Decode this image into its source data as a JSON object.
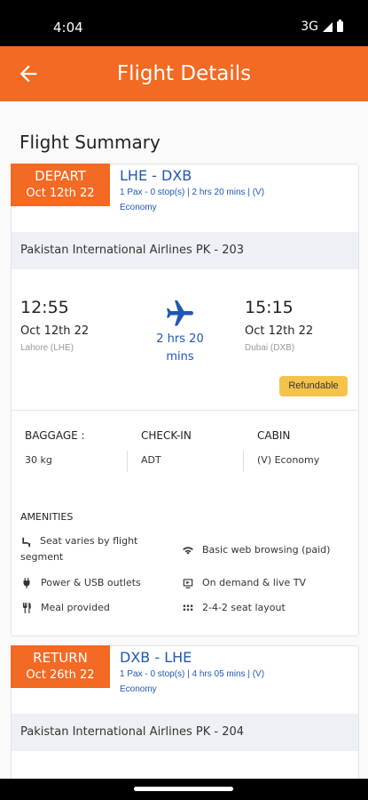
{
  "status": {
    "time": "4:04",
    "network": "3G"
  },
  "header": {
    "title": "Flight Details"
  },
  "summary_title": "Flight Summary",
  "depart": {
    "tag_type": "DEPART",
    "tag_date": "Oct 12th 22",
    "route": "LHE - DXB",
    "meta": "1 Pax - 0 stop(s) | 2 hrs 20 mins | (V)",
    "class": "Economy",
    "airline": "Pakistan International Airlines PK - 203",
    "dep_time": "12:55",
    "dep_date": "Oct 12th 22",
    "dep_city": "Lahore (LHE)",
    "duration": "2 hrs 20 mins",
    "arr_time": "15:15",
    "arr_date": "Oct 12th 22",
    "arr_city": "Dubai (DXB)",
    "refund_badge": "Refundable",
    "baggage_label": "BAGGAGE :",
    "baggage_value": "30 kg",
    "checkin_label": "CHECK-IN",
    "checkin_value": "ADT",
    "cabin_label": "CABIN",
    "cabin_value": "(V) Economy",
    "amenities_label": "AMENITIES",
    "amenities": [
      {
        "icon": "seat-icon",
        "text": "Seat varies by flight segment"
      },
      {
        "icon": "wifi-icon",
        "text": "Basic web browsing (paid)"
      },
      {
        "icon": "power-plug-icon",
        "text": "Power & USB outlets"
      },
      {
        "icon": "tv-icon",
        "text": "On demand & live TV"
      },
      {
        "icon": "meal-icon",
        "text": "Meal provided"
      },
      {
        "icon": "seat-layout-icon",
        "text": "2-4-2 seat layout"
      }
    ]
  },
  "return": {
    "tag_type": "RETURN",
    "tag_date": "Oct 26th 22",
    "route": "DXB - LHE",
    "meta": "1 Pax - 0 stop(s) | 4 hrs 05 mins | (V)",
    "class": "Economy",
    "airline": "Pakistan International Airlines PK - 204"
  },
  "colors": {
    "brand_orange": "#f26a23",
    "link_blue": "#1f57b5",
    "badge_yellow": "#f5c34b"
  }
}
